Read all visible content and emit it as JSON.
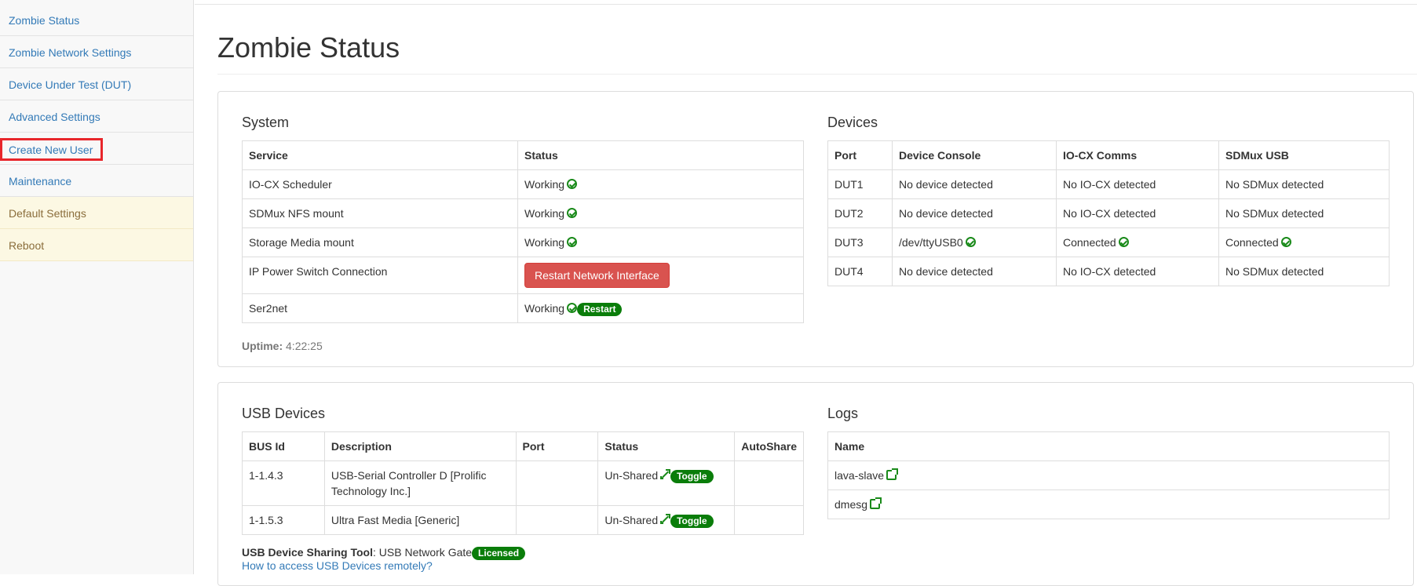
{
  "sidebar": {
    "items": [
      {
        "label": "Zombie Status"
      },
      {
        "label": "Zombie Network Settings"
      },
      {
        "label": "Device Under Test (DUT)"
      },
      {
        "label": "Advanced Settings"
      },
      {
        "label": "Create New User"
      },
      {
        "label": "Maintenance"
      },
      {
        "label": "Default Settings"
      },
      {
        "label": "Reboot"
      }
    ]
  },
  "page": {
    "title": "Zombie Status"
  },
  "system": {
    "heading": "System",
    "columns": [
      "Service",
      "Status"
    ],
    "rows": [
      {
        "service": "IO-CX Scheduler",
        "status": "Working"
      },
      {
        "service": "SDMux NFS mount",
        "status": "Working"
      },
      {
        "service": "Storage Media mount",
        "status": "Working"
      },
      {
        "service": "IP Power Switch Connection",
        "button": "Restart Network Interface"
      },
      {
        "service": "Ser2net",
        "status": "Working",
        "badge": "Restart"
      }
    ],
    "uptime_label": "Uptime:",
    "uptime_value": "4:22:25"
  },
  "devices": {
    "heading": "Devices",
    "columns": [
      "Port",
      "Device Console",
      "IO-CX Comms",
      "SDMux USB"
    ],
    "rows": [
      {
        "port": "DUT1",
        "console": "No device detected",
        "iocx": "No IO-CX detected",
        "sdmux": "No SDMux detected"
      },
      {
        "port": "DUT2",
        "console": "No device detected",
        "iocx": "No IO-CX detected",
        "sdmux": "No SDMux detected"
      },
      {
        "port": "DUT3",
        "console": "/dev/ttyUSB0",
        "iocx": "Connected",
        "sdmux": "Connected"
      },
      {
        "port": "DUT4",
        "console": "No device detected",
        "iocx": "No IO-CX detected",
        "sdmux": "No SDMux detected"
      }
    ]
  },
  "usb": {
    "heading": "USB Devices",
    "columns": [
      "BUS Id",
      "Description",
      "Port",
      "Status",
      "AutoShare"
    ],
    "rows": [
      {
        "bus": "1-1.4.3",
        "desc": "USB-Serial Controller D [Prolific Technology Inc.]",
        "port": "",
        "status": "Un-Shared",
        "toggle": "Toggle",
        "autoshare": ""
      },
      {
        "bus": "1-1.5.3",
        "desc": "Ultra Fast Media [Generic]",
        "port": "",
        "status": "Un-Shared",
        "toggle": "Toggle",
        "autoshare": ""
      }
    ],
    "tool_label": "USB Device Sharing Tool",
    "tool_value": ": USB Network Gate",
    "tool_badge": "Licensed",
    "help_link": "How to access USB Devices remotely?"
  },
  "logs": {
    "heading": "Logs",
    "columns": [
      "Name"
    ],
    "rows": [
      {
        "name": "lava-slave"
      },
      {
        "name": "dmesg"
      }
    ]
  },
  "colors": {
    "link": "#337ab7",
    "success": "#1a8a1a",
    "danger": "#d9534f",
    "warning_bg": "#fcf8e3",
    "highlight_box": "#e8262b"
  }
}
